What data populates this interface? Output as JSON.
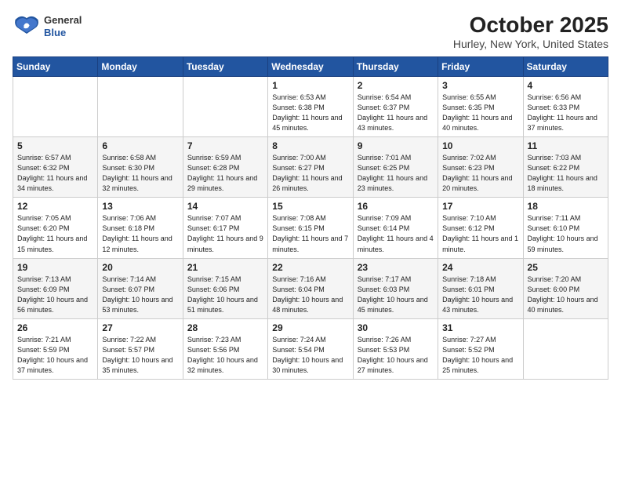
{
  "header": {
    "logo_general": "General",
    "logo_blue": "Blue",
    "month_title": "October 2025",
    "location": "Hurley, New York, United States"
  },
  "weekdays": [
    "Sunday",
    "Monday",
    "Tuesday",
    "Wednesday",
    "Thursday",
    "Friday",
    "Saturday"
  ],
  "weeks": [
    [
      {
        "day": "",
        "content": ""
      },
      {
        "day": "",
        "content": ""
      },
      {
        "day": "",
        "content": ""
      },
      {
        "day": "1",
        "content": "Sunrise: 6:53 AM\nSunset: 6:38 PM\nDaylight: 11 hours and 45 minutes."
      },
      {
        "day": "2",
        "content": "Sunrise: 6:54 AM\nSunset: 6:37 PM\nDaylight: 11 hours and 43 minutes."
      },
      {
        "day": "3",
        "content": "Sunrise: 6:55 AM\nSunset: 6:35 PM\nDaylight: 11 hours and 40 minutes."
      },
      {
        "day": "4",
        "content": "Sunrise: 6:56 AM\nSunset: 6:33 PM\nDaylight: 11 hours and 37 minutes."
      }
    ],
    [
      {
        "day": "5",
        "content": "Sunrise: 6:57 AM\nSunset: 6:32 PM\nDaylight: 11 hours and 34 minutes."
      },
      {
        "day": "6",
        "content": "Sunrise: 6:58 AM\nSunset: 6:30 PM\nDaylight: 11 hours and 32 minutes."
      },
      {
        "day": "7",
        "content": "Sunrise: 6:59 AM\nSunset: 6:28 PM\nDaylight: 11 hours and 29 minutes."
      },
      {
        "day": "8",
        "content": "Sunrise: 7:00 AM\nSunset: 6:27 PM\nDaylight: 11 hours and 26 minutes."
      },
      {
        "day": "9",
        "content": "Sunrise: 7:01 AM\nSunset: 6:25 PM\nDaylight: 11 hours and 23 minutes."
      },
      {
        "day": "10",
        "content": "Sunrise: 7:02 AM\nSunset: 6:23 PM\nDaylight: 11 hours and 20 minutes."
      },
      {
        "day": "11",
        "content": "Sunrise: 7:03 AM\nSunset: 6:22 PM\nDaylight: 11 hours and 18 minutes."
      }
    ],
    [
      {
        "day": "12",
        "content": "Sunrise: 7:05 AM\nSunset: 6:20 PM\nDaylight: 11 hours and 15 minutes."
      },
      {
        "day": "13",
        "content": "Sunrise: 7:06 AM\nSunset: 6:18 PM\nDaylight: 11 hours and 12 minutes."
      },
      {
        "day": "14",
        "content": "Sunrise: 7:07 AM\nSunset: 6:17 PM\nDaylight: 11 hours and 9 minutes."
      },
      {
        "day": "15",
        "content": "Sunrise: 7:08 AM\nSunset: 6:15 PM\nDaylight: 11 hours and 7 minutes."
      },
      {
        "day": "16",
        "content": "Sunrise: 7:09 AM\nSunset: 6:14 PM\nDaylight: 11 hours and 4 minutes."
      },
      {
        "day": "17",
        "content": "Sunrise: 7:10 AM\nSunset: 6:12 PM\nDaylight: 11 hours and 1 minute."
      },
      {
        "day": "18",
        "content": "Sunrise: 7:11 AM\nSunset: 6:10 PM\nDaylight: 10 hours and 59 minutes."
      }
    ],
    [
      {
        "day": "19",
        "content": "Sunrise: 7:13 AM\nSunset: 6:09 PM\nDaylight: 10 hours and 56 minutes."
      },
      {
        "day": "20",
        "content": "Sunrise: 7:14 AM\nSunset: 6:07 PM\nDaylight: 10 hours and 53 minutes."
      },
      {
        "day": "21",
        "content": "Sunrise: 7:15 AM\nSunset: 6:06 PM\nDaylight: 10 hours and 51 minutes."
      },
      {
        "day": "22",
        "content": "Sunrise: 7:16 AM\nSunset: 6:04 PM\nDaylight: 10 hours and 48 minutes."
      },
      {
        "day": "23",
        "content": "Sunrise: 7:17 AM\nSunset: 6:03 PM\nDaylight: 10 hours and 45 minutes."
      },
      {
        "day": "24",
        "content": "Sunrise: 7:18 AM\nSunset: 6:01 PM\nDaylight: 10 hours and 43 minutes."
      },
      {
        "day": "25",
        "content": "Sunrise: 7:20 AM\nSunset: 6:00 PM\nDaylight: 10 hours and 40 minutes."
      }
    ],
    [
      {
        "day": "26",
        "content": "Sunrise: 7:21 AM\nSunset: 5:59 PM\nDaylight: 10 hours and 37 minutes."
      },
      {
        "day": "27",
        "content": "Sunrise: 7:22 AM\nSunset: 5:57 PM\nDaylight: 10 hours and 35 minutes."
      },
      {
        "day": "28",
        "content": "Sunrise: 7:23 AM\nSunset: 5:56 PM\nDaylight: 10 hours and 32 minutes."
      },
      {
        "day": "29",
        "content": "Sunrise: 7:24 AM\nSunset: 5:54 PM\nDaylight: 10 hours and 30 minutes."
      },
      {
        "day": "30",
        "content": "Sunrise: 7:26 AM\nSunset: 5:53 PM\nDaylight: 10 hours and 27 minutes."
      },
      {
        "day": "31",
        "content": "Sunrise: 7:27 AM\nSunset: 5:52 PM\nDaylight: 10 hours and 25 minutes."
      },
      {
        "day": "",
        "content": ""
      }
    ]
  ]
}
